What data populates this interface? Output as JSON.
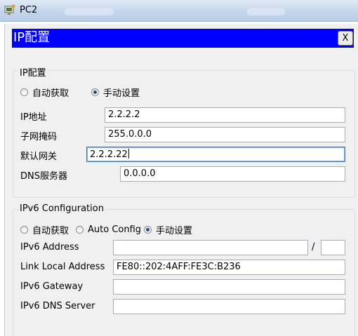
{
  "window": {
    "title": "PC2"
  },
  "dialog": {
    "title": "IP配置",
    "close_label": "X"
  },
  "ipv4": {
    "group_label": "IP配置",
    "mode_options": [
      {
        "label": "自动获取",
        "selected": false
      },
      {
        "label": "手动设置",
        "selected": true
      }
    ],
    "fields": {
      "ip": {
        "label": "IP地址",
        "value": "2.2.2.2"
      },
      "mask": {
        "label": "子网掩码",
        "value": "255.0.0.0"
      },
      "gateway": {
        "label": "默认网关",
        "value": "2.2.2.22"
      },
      "dns": {
        "label": "DNS服务器",
        "value": "0.0.0.0"
      }
    }
  },
  "ipv6": {
    "group_label": "IPv6 Configuration",
    "mode_options": [
      {
        "label": "自动获取",
        "selected": false
      },
      {
        "label": "Auto Config",
        "selected": false
      },
      {
        "label": "手动设置",
        "selected": true
      }
    ],
    "fields": {
      "address": {
        "label": "IPv6 Address",
        "value": "",
        "separator": "/",
        "prefix": ""
      },
      "link_local": {
        "label": "Link Local Address",
        "value": "FE80::202:4AFF:FE3C:B236"
      },
      "gateway": {
        "label": "IPv6 Gateway",
        "value": ""
      },
      "dns": {
        "label": "IPv6 DNS Server",
        "value": ""
      }
    }
  },
  "colors": {
    "header_bg": "#0000ff",
    "header_text": "#ffffff",
    "dialog_bg": "#f0f0f0"
  }
}
